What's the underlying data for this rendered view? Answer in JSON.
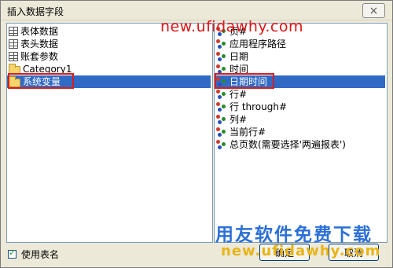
{
  "window": {
    "title": "插入数据字段",
    "close_label": "×"
  },
  "left_list": [
    {
      "label": "表体数据",
      "icon": "table-icon"
    },
    {
      "label": "表头数据",
      "icon": "table-icon"
    },
    {
      "label": "账套参数",
      "icon": "table-icon"
    },
    {
      "label": "Category1",
      "icon": "folder-icon"
    },
    {
      "label": "系统变量",
      "icon": "folder-icon",
      "selected": true
    }
  ],
  "right_list": [
    {
      "label": "页#"
    },
    {
      "label": "应用程序路径"
    },
    {
      "label": "日期"
    },
    {
      "label": "时间"
    },
    {
      "label": "日期时间",
      "selected": true
    },
    {
      "label": "行#"
    },
    {
      "label": "行 through#"
    },
    {
      "label": "列#"
    },
    {
      "label": "当前行#"
    },
    {
      "label": "总页数(需要选择'两遍报表')"
    }
  ],
  "footer": {
    "use_table_name_label": "使用表名",
    "use_table_name_checked": true,
    "ok_label": "确定",
    "cancel_label": "取消"
  },
  "watermarks": {
    "top": "new.ufidawhy.com",
    "big": "用友软件免费下载",
    "small": "new.ufidawhy.com"
  },
  "colors": {
    "selection": "#316ac5",
    "highlight_box": "#d81c1c",
    "dialog_bg": "#ece9d8"
  }
}
